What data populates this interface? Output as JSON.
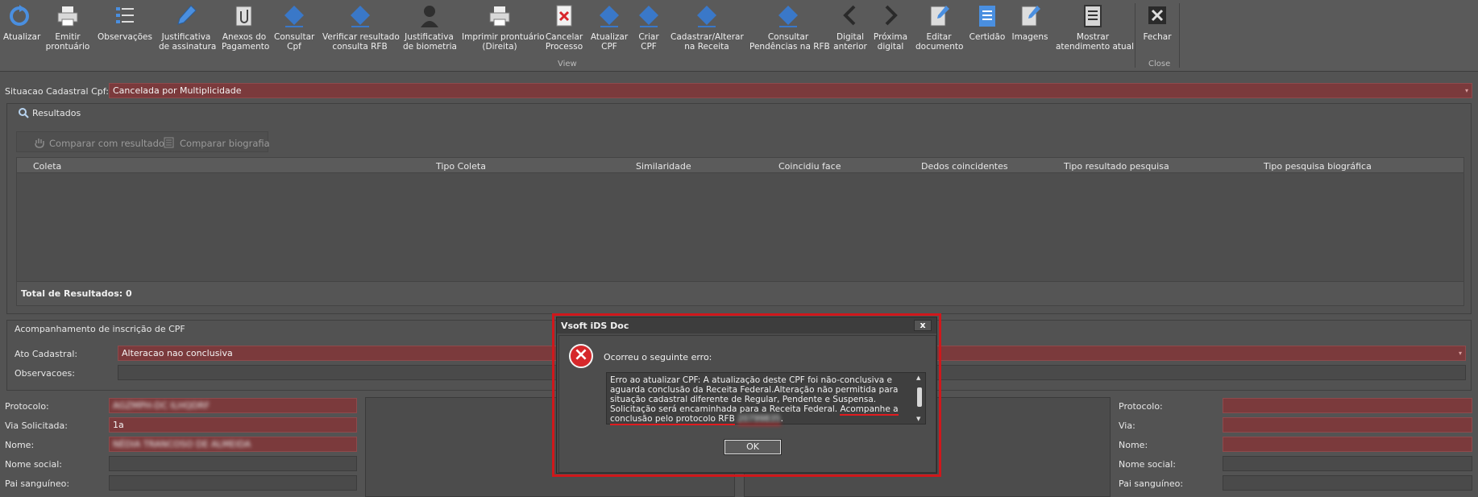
{
  "ribbon": {
    "buttons": [
      {
        "id": "atualizar",
        "label": "Atualizar",
        "icon": "refresh-icon"
      },
      {
        "id": "emitir",
        "label": "Emitir\nprontuário",
        "icon": "printer-icon"
      },
      {
        "id": "observacoes",
        "label": "Observações",
        "icon": "list-icon"
      },
      {
        "id": "justificativa-assinatura",
        "label": "Justificativa\nde assinatura",
        "icon": "pen-icon"
      },
      {
        "id": "anexos",
        "label": "Anexos do\nPagamento",
        "icon": "attachment-icon"
      },
      {
        "id": "consultar-cpf",
        "label": "Consultar\nCpf",
        "icon": "receita-federal-icon"
      },
      {
        "id": "verificar-rfb",
        "label": "Verificar resultado\nconsulta RFB",
        "icon": "receita-federal-icon"
      },
      {
        "id": "justificativa-biometria",
        "label": "Justificativa\nde biometria",
        "icon": "person-icon"
      },
      {
        "id": "imprimir-direita",
        "label": "Imprimir prontuário\n(Direita)",
        "icon": "printer-icon"
      },
      {
        "id": "cancelar-processo",
        "label": "Cancelar\nProcesso",
        "icon": "cancel-document-icon"
      },
      {
        "id": "atualizar-cpf",
        "label": "Atualizar\nCPF",
        "icon": "receita-federal-icon"
      },
      {
        "id": "criar-cpf",
        "label": "Criar\nCPF",
        "icon": "receita-federal-icon"
      },
      {
        "id": "cadastrar-alterar",
        "label": "Cadastrar/Alterar\nna Receita",
        "icon": "receita-federal-icon"
      },
      {
        "id": "consultar-pendencias",
        "label": "Consultar\nPendências na RFB",
        "icon": "receita-federal-icon"
      },
      {
        "id": "digital-anterior",
        "label": "Digital\nanterior",
        "icon": "chevron-left-icon"
      },
      {
        "id": "proxima-digital",
        "label": "Próxima\ndigital",
        "icon": "chevron-right-icon"
      },
      {
        "id": "editar-documento",
        "label": "Editar\ndocumento",
        "icon": "edit-document-icon"
      },
      {
        "id": "certidao",
        "label": "Certidão",
        "icon": "certificate-icon"
      },
      {
        "id": "imagens",
        "label": "Imagens",
        "icon": "images-icon"
      },
      {
        "id": "mostrar-atendimento",
        "label": "Mostrar\natendimento atual",
        "icon": "document-icon"
      },
      {
        "id": "fechar",
        "label": "Fechar",
        "icon": "close-x-icon"
      }
    ],
    "group_view": "View",
    "group_close": "Close"
  },
  "situacao": {
    "label": "Situacao Cadastral Cpf:",
    "value": "Cancelada por Multiplicidade"
  },
  "resultados": {
    "title": "Resultados",
    "compare_result": "Comparar com resultado",
    "compare_bio": "Comparar biografia",
    "columns": [
      "Coleta",
      "Tipo Coleta",
      "Similaridade",
      "Coincidiu face",
      "Dedos coincidentes",
      "Tipo resultado pesquisa",
      "Tipo pesquisa biográfica"
    ],
    "total": "Total de Resultados: 0"
  },
  "acompanhamento": {
    "title": "Acompanhamento de inscrição de CPF",
    "ato_label": "Ato Cadastral:",
    "ato_value": "Alteracao nao conclusiva",
    "obs_label": "Observacoes:"
  },
  "form_left": {
    "protocolo_label": "Protocolo:",
    "protocolo_value": "AGZMPH-DC ILHQDRF",
    "via_label": "Via Solicitada:",
    "via_value": "1a",
    "nome_label": "Nome:",
    "nome_value": "NÉDIA TRANCOSO DE ALMEIDA",
    "nome_social_label": "Nome social:",
    "pai_label": "Pai sanguíneo:"
  },
  "form_right": {
    "protocolo_label": "Protocolo:",
    "via_label": "Via:",
    "nome_label": "Nome:",
    "nome_social_label": "Nome social:",
    "pai_label": "Pai sanguíneo:"
  },
  "dialog": {
    "title": "Vsoft iDS Doc",
    "close": "x",
    "heading": "Ocorreu o seguinte erro:",
    "message_main": "Erro ao atualizar CPF: A atualização deste CPF foi não-conclusiva e aguarda conclusão da Receita Federal.Alteração não permitida para situação cadastral diferente de Regular, Pendente e Suspensa. Solicitação será encaminhada para a Receita Federal. ",
    "message_highlight": "Acompanhe a conclusão pelo protocolo RFB",
    "protocol_number": "20799835",
    "ok": "OK"
  },
  "colors": {
    "error_field": "#7b3a3c",
    "highlight_outline": "#d0171b",
    "rfb_blue": "#3a78c8"
  }
}
